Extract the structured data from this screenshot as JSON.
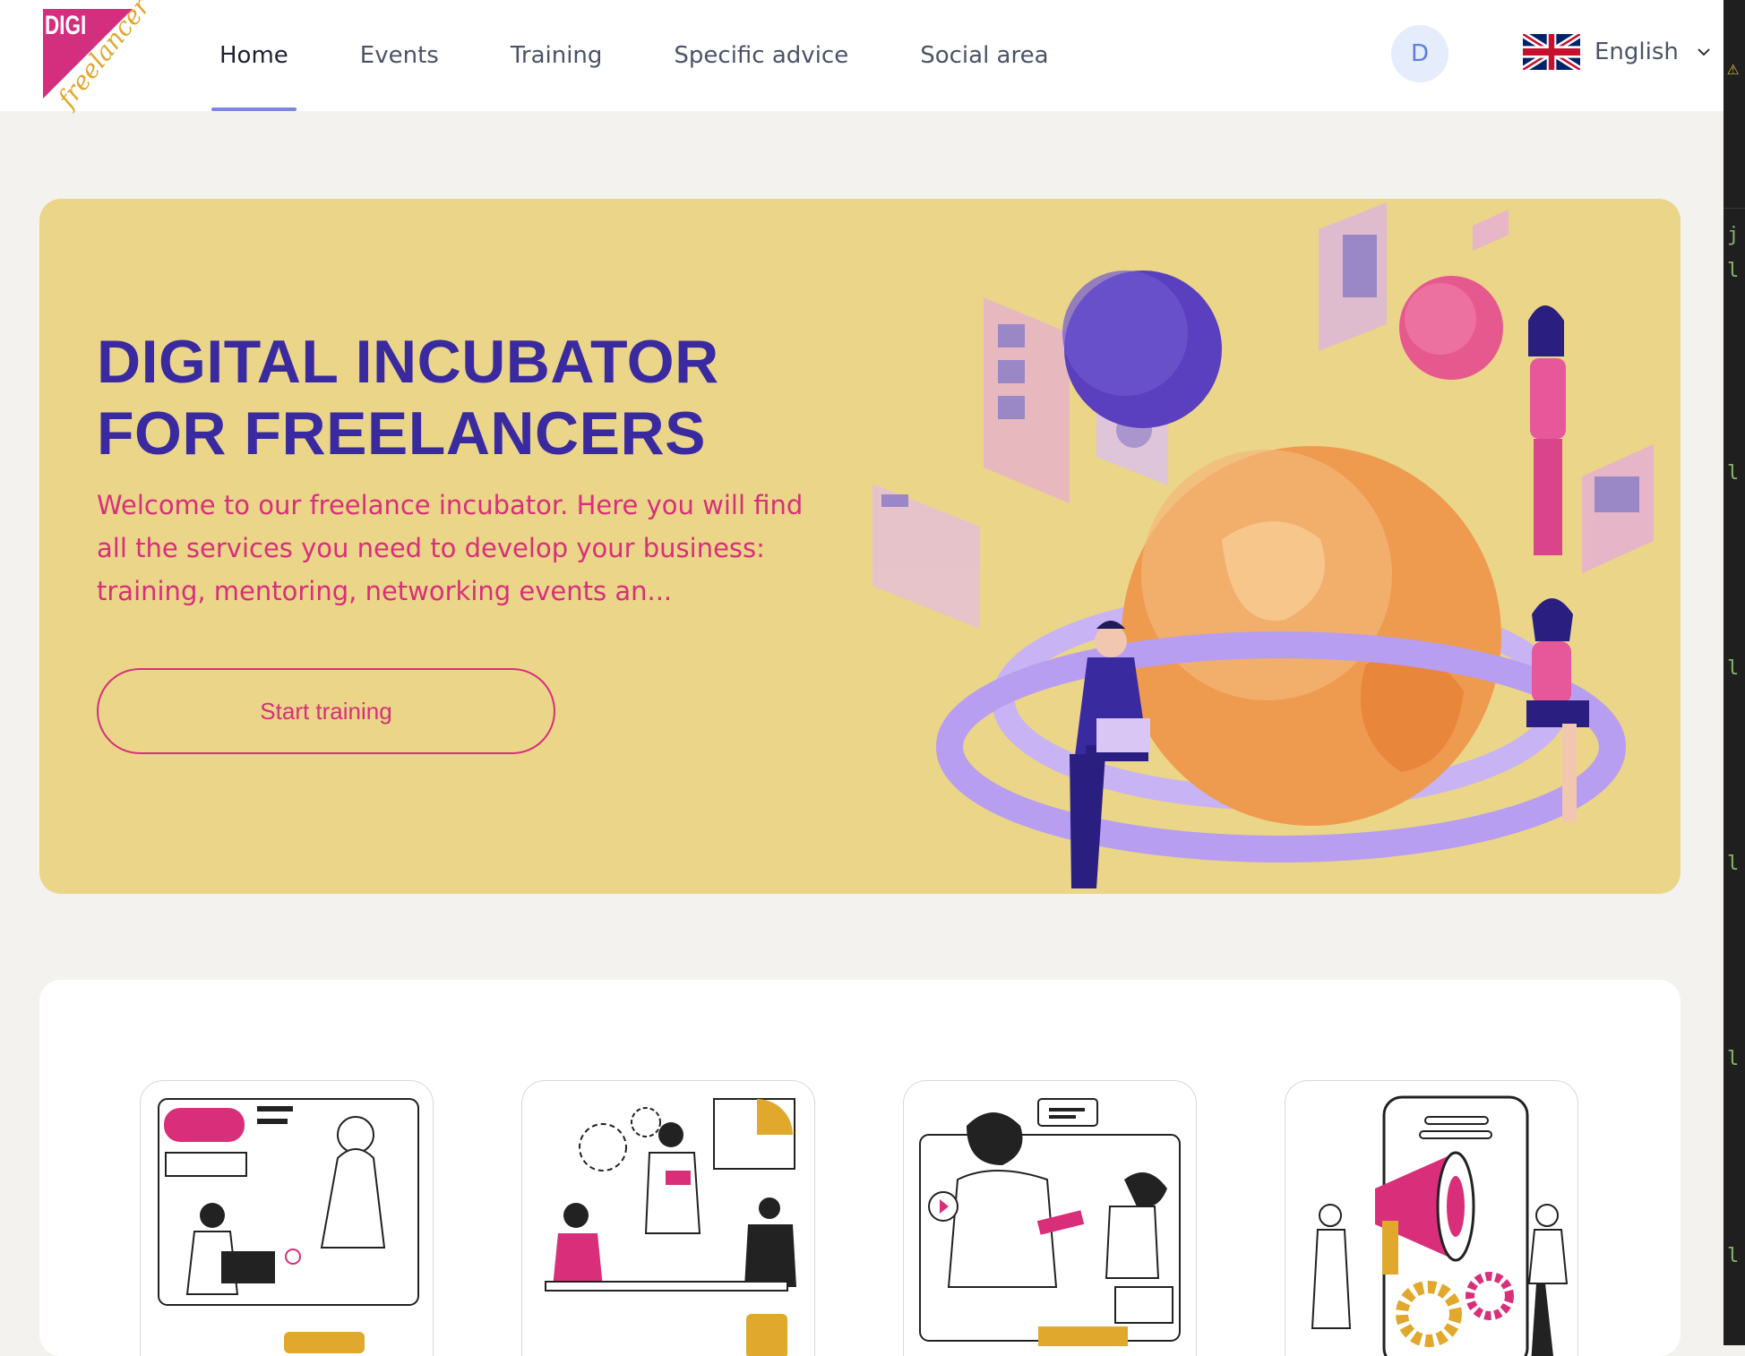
{
  "logo": {
    "line1": "DIGI",
    "line2": "freelancer"
  },
  "nav": {
    "items": [
      {
        "label": "Home",
        "active": true
      },
      {
        "label": "Events",
        "active": false
      },
      {
        "label": "Training",
        "active": false
      },
      {
        "label": "Specific advice",
        "active": false
      },
      {
        "label": "Social area",
        "active": false
      }
    ]
  },
  "user": {
    "avatar_initial": "D"
  },
  "language": {
    "label": "English",
    "flag": "uk-flag-icon"
  },
  "hero": {
    "title_line1": "DIGITAL INCUBATOR",
    "title_line2": "FOR FREELANCERS",
    "description": "Welcome to our freelance incubator. Here you will find all the services you need to develop your business: training, mentoring, networking events an...",
    "cta_label": "Start training"
  },
  "services": {
    "cards": [
      {
        "illustration": "online-training-illustration"
      },
      {
        "illustration": "team-meeting-illustration"
      },
      {
        "illustration": "video-mentoring-illustration"
      },
      {
        "illustration": "marketing-megaphone-illustration"
      }
    ]
  },
  "colors": {
    "hero_bg": "#ead589",
    "title": "#3a2aa0",
    "accent_pink": "#d92f7a",
    "nav_active": "#7e86e4",
    "page_bg": "#f3f2ee"
  }
}
